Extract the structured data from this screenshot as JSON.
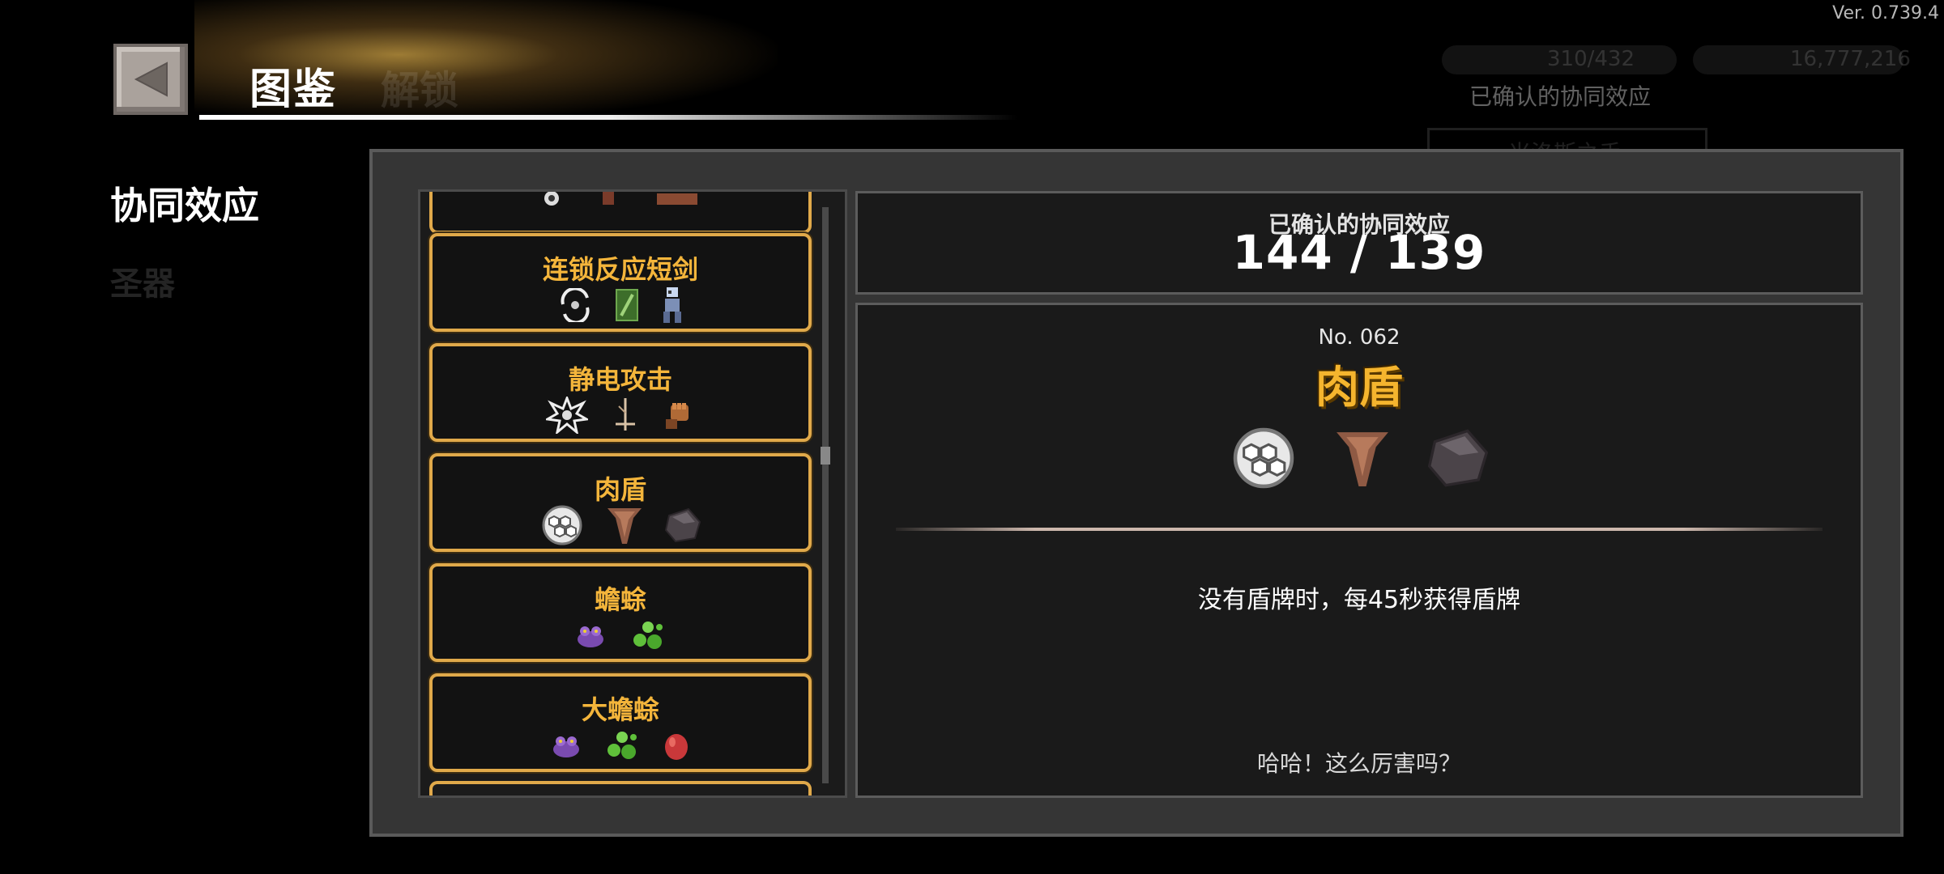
{
  "version": "Ver. 0.739.4",
  "header": {
    "title": "图鉴",
    "ghost_title": "解锁"
  },
  "background_ui": {
    "stat1": "310/432",
    "stat2": "16,777,216",
    "confirmed_label": "已确认的协同效应",
    "card_label": "米洛斯之手"
  },
  "left_nav": {
    "synergy": "协同效应",
    "relic": "圣器"
  },
  "list": {
    "items": [
      {
        "name": "连锁反应短剑",
        "icons": [
          "chain-spin-icon",
          "green-leaf-card-icon",
          "robot-figure-icon"
        ]
      },
      {
        "name": "静电攻击",
        "icons": [
          "static-burst-icon",
          "lightning-rod-icon",
          "fist-glove-icon"
        ]
      },
      {
        "name": "肉盾",
        "icons": [
          "hexagon-shield-icon",
          "meat-cape-icon",
          "dark-stone-icon"
        ],
        "selected": true
      },
      {
        "name": "蟾蜍",
        "icons": [
          "purple-toad-icon",
          "green-bubbles-icon"
        ]
      },
      {
        "name": "大蟾蜍",
        "icons": [
          "purple-toad-icon",
          "green-bubbles-icon",
          "red-egg-icon"
        ]
      }
    ]
  },
  "summary": {
    "label": "已确认的协同效应",
    "count": "144 / 139"
  },
  "detail": {
    "number": "No. 062",
    "name": "肉盾",
    "icons": [
      "hexagon-shield-icon",
      "meat-cape-icon",
      "dark-stone-icon"
    ],
    "effect": "没有盾牌时，每45秒获得盾牌",
    "quote": "哈哈！这么厉害吗？"
  },
  "colors": {
    "accent_gold": "#f4b53b",
    "card_border": "#e0a94a",
    "panel_bg": "#353535",
    "box_bg": "#1a1a1a"
  }
}
